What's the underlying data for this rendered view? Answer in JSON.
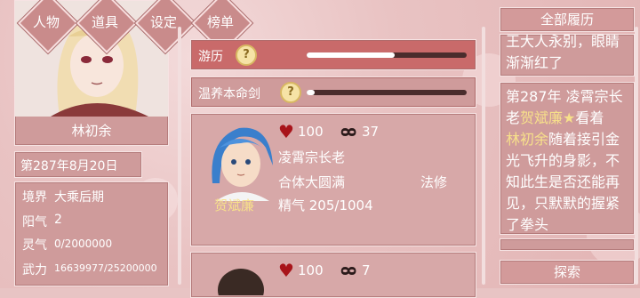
{
  "nav": {
    "character": "人物",
    "items": "道具",
    "settings": "设定",
    "ranking": "榜单"
  },
  "player": {
    "name": "林初余",
    "date": "第287年8月20日",
    "realm_label": "境界",
    "realm_value": "大乘后期",
    "yang_label": "阳气",
    "yang_value": "2",
    "spirit_label": "灵气",
    "spirit_value": "0/2000000",
    "power_label": "武力",
    "power_value": "16639977/25200000"
  },
  "activities": [
    {
      "label": "游历",
      "hint": "?",
      "progress": 0.55
    },
    {
      "label": "温养本命剑",
      "hint": "?",
      "progress": 0.05
    }
  ],
  "npc_card": {
    "name": "贺斌廉",
    "affection": "100",
    "bond": "37",
    "title": "凌霄宗长老",
    "realm": "合体大圆满",
    "class": "法修",
    "essence": "精气 205/1004"
  },
  "npc_card2": {
    "affection": "100",
    "bond": "7"
  },
  "right": {
    "history_button": "全部履历",
    "explore_button": "探索",
    "log_top": "王大人永别，眼睛渐渐红了",
    "log_top_line1": "王大人永别，眼睛",
    "log_top_line2": "渐渐红了",
    "log_lines": [
      "第287年 凌霄宗长",
      "老",
      "贺斌廉★",
      "看着",
      "林初余",
      "随着接引金",
      "光飞升的身影，不",
      "知此生是否还能再",
      "见，只默默的握紧",
      "了拳头"
    ]
  },
  "colors": {
    "panel": "#cf9b9b",
    "highlight_name": "#f7e08a",
    "heart": "#a8141a"
  }
}
